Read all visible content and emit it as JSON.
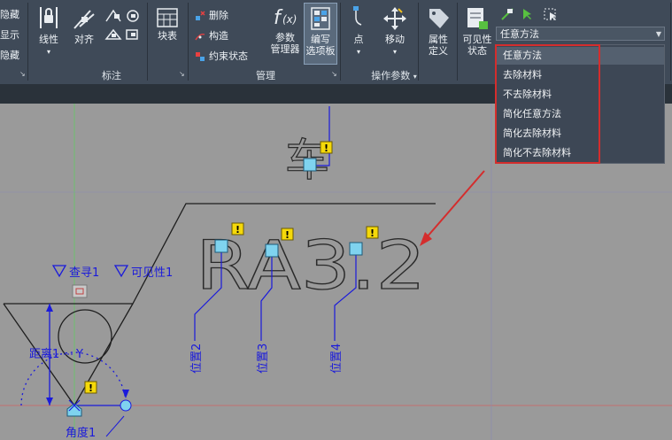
{
  "ribbon": {
    "left_partial": [
      "隐藏",
      "显示",
      "隐藏"
    ],
    "annotate": {
      "linear_label": "线性",
      "align_label": "对齐",
      "table_label": "块表",
      "group_label": "标注"
    },
    "manage": {
      "delete_label": "删除",
      "construct_label": "构造",
      "constraint_label": "约束状态",
      "param_mgr_label": [
        "参数",
        "管理器"
      ],
      "edit_palette_label": [
        "编写",
        "选项板"
      ],
      "group_label": "管理"
    },
    "action": {
      "point_label": "点",
      "move_label": "移动",
      "group_label": "操作参数"
    },
    "attr_label": [
      "属性",
      "定义"
    ],
    "visibility_label": [
      "可见性",
      "状态"
    ]
  },
  "visibility_combo": {
    "value": "任意方法",
    "options": [
      "任意方法",
      "去除材料",
      "不去除材料",
      "简化任意方法",
      "简化去除材料",
      "简化不去除材料"
    ],
    "selected_index": 0
  },
  "drawing": {
    "surface_text": "RA3.2",
    "symbol_char": "车",
    "lookup_label": "查寻1",
    "visibility_label": "可见性1",
    "distance_label": "距离1",
    "y_label": "Y",
    "angle_label": "角度1",
    "position_labels": [
      "位置2",
      "位置3",
      "位置4"
    ],
    "warning_glyph": "!"
  },
  "colors": {
    "ribbon_bg": "#3f4a58",
    "canvas_bg": "#9a9a9a",
    "highlight_red": "#d42d2d",
    "param_blue": "#1a1adb",
    "grip_cyan": "#7fd3ef",
    "warning_yellow": "#f5d90a"
  }
}
